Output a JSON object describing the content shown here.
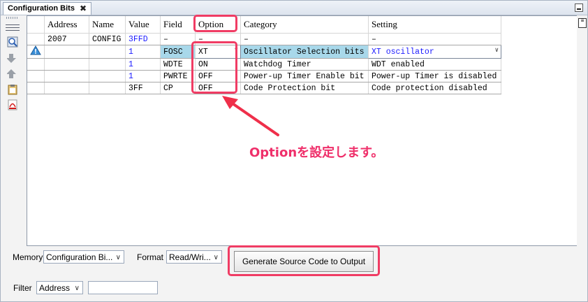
{
  "tab": {
    "title": "Configuration Bits",
    "close": "✖"
  },
  "table": {
    "headers": [
      "Address",
      "Name",
      "Value",
      "Field",
      "Option",
      "Category",
      "Setting"
    ],
    "rows": [
      {
        "address": "2007",
        "name": "CONFIG",
        "value": "3FFD",
        "field": "–",
        "option": "–",
        "category": "–",
        "setting": "–"
      },
      {
        "address": "",
        "name": "",
        "value": "1",
        "field": "FOSC",
        "option": "XT",
        "category": "Oscillator Selection bits",
        "setting": "XT oscillator"
      },
      {
        "address": "",
        "name": "",
        "value": "1",
        "field": "WDTE",
        "option": "ON",
        "category": "Watchdog Timer",
        "setting": "WDT enabled"
      },
      {
        "address": "",
        "name": "",
        "value": "1",
        "field": "PWRTE",
        "option": "OFF",
        "category": "Power-up Timer Enable bit",
        "setting": "Power-up Timer is disabled"
      },
      {
        "address": "",
        "name": "",
        "value": "3FF",
        "field": "CP",
        "option": "OFF",
        "category": "Code Protection bit",
        "setting": "Code protection disabled"
      }
    ]
  },
  "controls": {
    "memory_label": "Memory",
    "memory_value": "Configuration Bi...",
    "format_label": "Format",
    "format_value": "Read/Wri...",
    "generate_button": "Generate Source Code to Output",
    "filter_label": "Filter",
    "filter_value": "Address",
    "filter_text": ""
  },
  "annotation": {
    "text": "Optionを設定します。"
  },
  "colors": {
    "highlight_red": "#f03c64",
    "value_blue": "#1a1aff",
    "fosc_highlight": "#a8d8ea"
  }
}
